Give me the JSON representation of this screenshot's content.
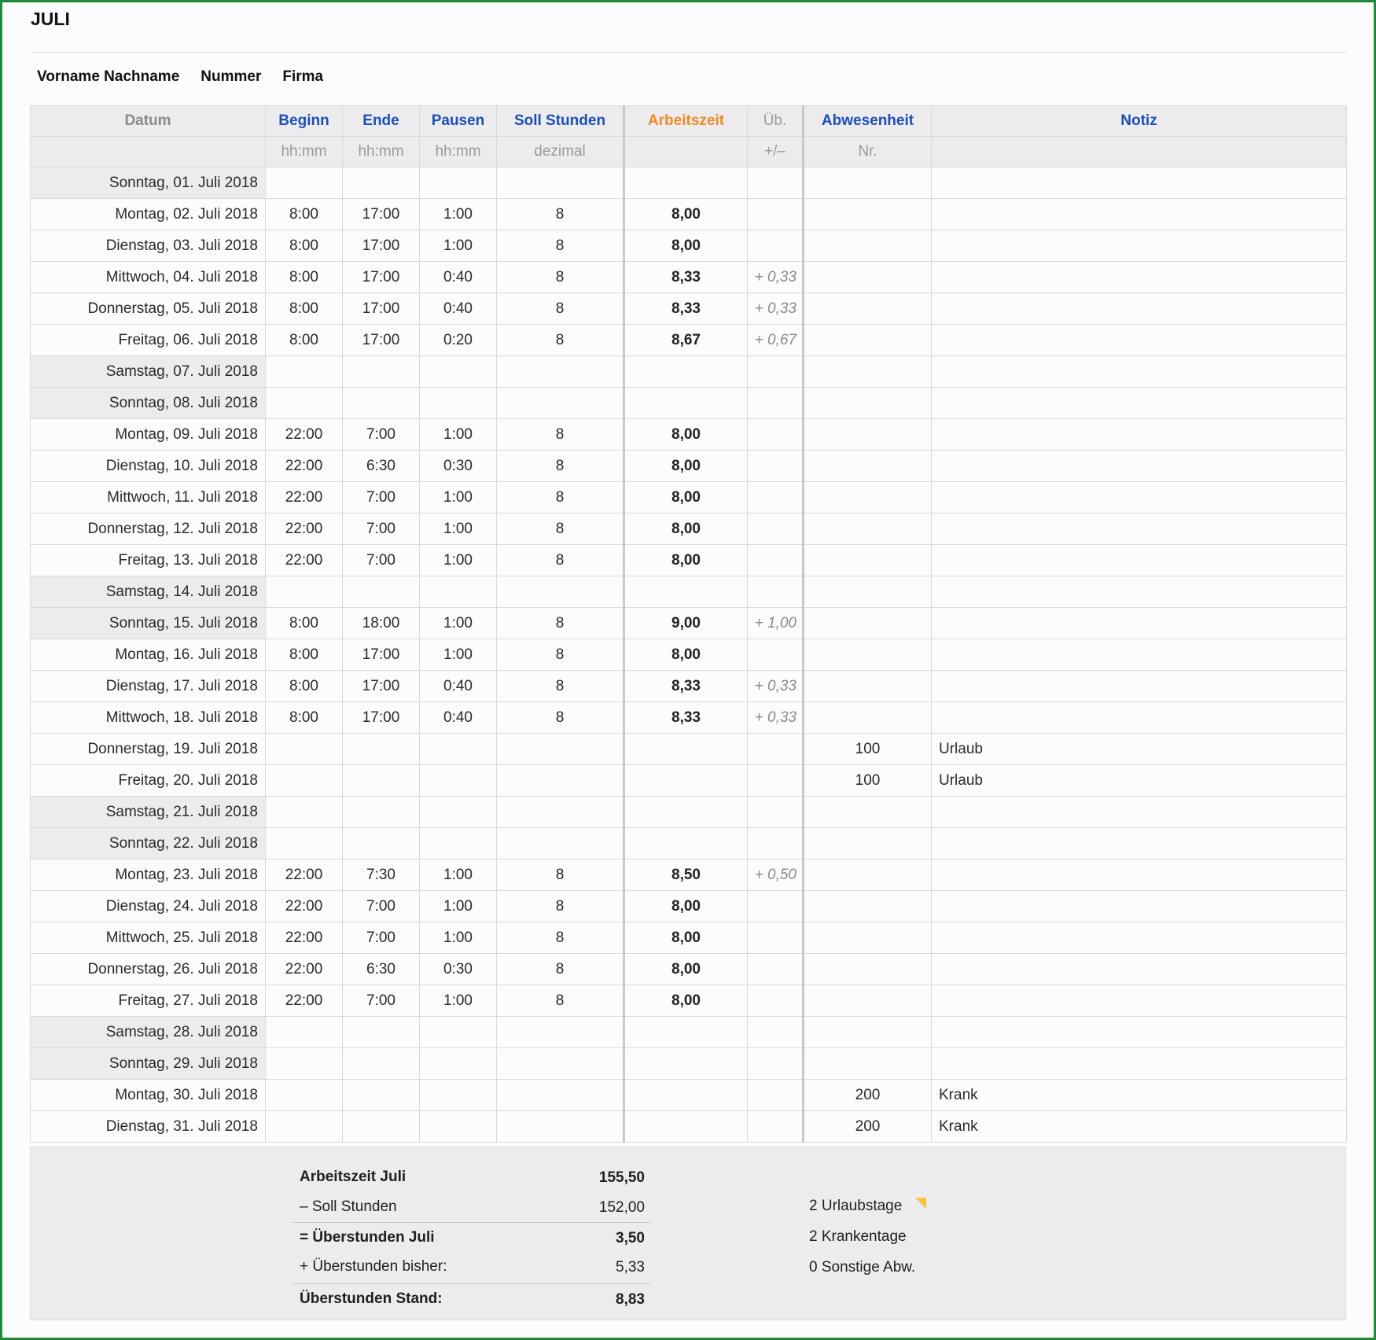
{
  "title": "JULI",
  "meta": {
    "name": "Vorname Nachname",
    "number": "Nummer",
    "company": "Firma"
  },
  "columns": {
    "datum": "Datum",
    "beginn": "Beginn",
    "ende": "Ende",
    "pausen": "Pausen",
    "soll": "Soll Stunden",
    "arbeitszeit": "Arbeitszeit",
    "ueb": "Üb.",
    "abwesenheit": "Abwesenheit",
    "notiz": "Notiz",
    "beginn_fmt": "hh:mm",
    "ende_fmt": "hh:mm",
    "pausen_fmt": "hh:mm",
    "soll_fmt": "dezimal",
    "ueb_fmt": "+/–",
    "abwesenheit_fmt": "Nr."
  },
  "rows": [
    {
      "date": "Sonntag, 01. Juli 2018",
      "weekend": true,
      "begin": "",
      "end": "",
      "pause": "",
      "soll": "",
      "work": "",
      "over": "",
      "abw": "",
      "note": ""
    },
    {
      "date": "Montag, 02. Juli 2018",
      "weekend": false,
      "begin": "8:00",
      "end": "17:00",
      "pause": "1:00",
      "soll": "8",
      "work": "8,00",
      "over": "",
      "abw": "",
      "note": ""
    },
    {
      "date": "Dienstag, 03. Juli 2018",
      "weekend": false,
      "begin": "8:00",
      "end": "17:00",
      "pause": "1:00",
      "soll": "8",
      "work": "8,00",
      "over": "",
      "abw": "",
      "note": ""
    },
    {
      "date": "Mittwoch, 04. Juli 2018",
      "weekend": false,
      "begin": "8:00",
      "end": "17:00",
      "pause": "0:40",
      "soll": "8",
      "work": "8,33",
      "over": "+ 0,33",
      "abw": "",
      "note": ""
    },
    {
      "date": "Donnerstag, 05. Juli 2018",
      "weekend": false,
      "begin": "8:00",
      "end": "17:00",
      "pause": "0:40",
      "soll": "8",
      "work": "8,33",
      "over": "+ 0,33",
      "abw": "",
      "note": ""
    },
    {
      "date": "Freitag, 06. Juli 2018",
      "weekend": false,
      "begin": "8:00",
      "end": "17:00",
      "pause": "0:20",
      "soll": "8",
      "work": "8,67",
      "over": "+ 0,67",
      "abw": "",
      "note": ""
    },
    {
      "date": "Samstag, 07. Juli 2018",
      "weekend": true,
      "begin": "",
      "end": "",
      "pause": "",
      "soll": "",
      "work": "",
      "over": "",
      "abw": "",
      "note": ""
    },
    {
      "date": "Sonntag, 08. Juli 2018",
      "weekend": true,
      "begin": "",
      "end": "",
      "pause": "",
      "soll": "",
      "work": "",
      "over": "",
      "abw": "",
      "note": ""
    },
    {
      "date": "Montag, 09. Juli 2018",
      "weekend": false,
      "begin": "22:00",
      "end": "7:00",
      "pause": "1:00",
      "soll": "8",
      "work": "8,00",
      "over": "",
      "abw": "",
      "note": ""
    },
    {
      "date": "Dienstag, 10. Juli 2018",
      "weekend": false,
      "begin": "22:00",
      "end": "6:30",
      "pause": "0:30",
      "soll": "8",
      "work": "8,00",
      "over": "",
      "abw": "",
      "note": ""
    },
    {
      "date": "Mittwoch, 11. Juli 2018",
      "weekend": false,
      "begin": "22:00",
      "end": "7:00",
      "pause": "1:00",
      "soll": "8",
      "work": "8,00",
      "over": "",
      "abw": "",
      "note": ""
    },
    {
      "date": "Donnerstag, 12. Juli 2018",
      "weekend": false,
      "begin": "22:00",
      "end": "7:00",
      "pause": "1:00",
      "soll": "8",
      "work": "8,00",
      "over": "",
      "abw": "",
      "note": ""
    },
    {
      "date": "Freitag, 13. Juli 2018",
      "weekend": false,
      "begin": "22:00",
      "end": "7:00",
      "pause": "1:00",
      "soll": "8",
      "work": "8,00",
      "over": "",
      "abw": "",
      "note": ""
    },
    {
      "date": "Samstag, 14. Juli 2018",
      "weekend": true,
      "begin": "",
      "end": "",
      "pause": "",
      "soll": "",
      "work": "",
      "over": "",
      "abw": "",
      "note": ""
    },
    {
      "date": "Sonntag, 15. Juli 2018",
      "weekend": true,
      "begin": "8:00",
      "end": "18:00",
      "pause": "1:00",
      "soll": "8",
      "work": "9,00",
      "over": "+ 1,00",
      "abw": "",
      "note": ""
    },
    {
      "date": "Montag, 16. Juli 2018",
      "weekend": false,
      "begin": "8:00",
      "end": "17:00",
      "pause": "1:00",
      "soll": "8",
      "work": "8,00",
      "over": "",
      "abw": "",
      "note": ""
    },
    {
      "date": "Dienstag, 17. Juli 2018",
      "weekend": false,
      "begin": "8:00",
      "end": "17:00",
      "pause": "0:40",
      "soll": "8",
      "work": "8,33",
      "over": "+ 0,33",
      "abw": "",
      "note": ""
    },
    {
      "date": "Mittwoch, 18. Juli 2018",
      "weekend": false,
      "begin": "8:00",
      "end": "17:00",
      "pause": "0:40",
      "soll": "8",
      "work": "8,33",
      "over": "+ 0,33",
      "abw": "",
      "note": ""
    },
    {
      "date": "Donnerstag, 19. Juli 2018",
      "weekend": false,
      "begin": "",
      "end": "",
      "pause": "",
      "soll": "",
      "work": "",
      "over": "",
      "abw": "100",
      "note": "Urlaub"
    },
    {
      "date": "Freitag, 20. Juli 2018",
      "weekend": false,
      "begin": "",
      "end": "",
      "pause": "",
      "soll": "",
      "work": "",
      "over": "",
      "abw": "100",
      "note": "Urlaub"
    },
    {
      "date": "Samstag, 21. Juli 2018",
      "weekend": true,
      "begin": "",
      "end": "",
      "pause": "",
      "soll": "",
      "work": "",
      "over": "",
      "abw": "",
      "note": ""
    },
    {
      "date": "Sonntag, 22. Juli 2018",
      "weekend": true,
      "begin": "",
      "end": "",
      "pause": "",
      "soll": "",
      "work": "",
      "over": "",
      "abw": "",
      "note": ""
    },
    {
      "date": "Montag, 23. Juli 2018",
      "weekend": false,
      "begin": "22:00",
      "end": "7:30",
      "pause": "1:00",
      "soll": "8",
      "work": "8,50",
      "over": "+ 0,50",
      "abw": "",
      "note": ""
    },
    {
      "date": "Dienstag, 24. Juli 2018",
      "weekend": false,
      "begin": "22:00",
      "end": "7:00",
      "pause": "1:00",
      "soll": "8",
      "work": "8,00",
      "over": "",
      "abw": "",
      "note": ""
    },
    {
      "date": "Mittwoch, 25. Juli 2018",
      "weekend": false,
      "begin": "22:00",
      "end": "7:00",
      "pause": "1:00",
      "soll": "8",
      "work": "8,00",
      "over": "",
      "abw": "",
      "note": ""
    },
    {
      "date": "Donnerstag, 26. Juli 2018",
      "weekend": false,
      "begin": "22:00",
      "end": "6:30",
      "pause": "0:30",
      "soll": "8",
      "work": "8,00",
      "over": "",
      "abw": "",
      "note": ""
    },
    {
      "date": "Freitag, 27. Juli 2018",
      "weekend": false,
      "begin": "22:00",
      "end": "7:00",
      "pause": "1:00",
      "soll": "8",
      "work": "8,00",
      "over": "",
      "abw": "",
      "note": ""
    },
    {
      "date": "Samstag, 28. Juli 2018",
      "weekend": true,
      "begin": "",
      "end": "",
      "pause": "",
      "soll": "",
      "work": "",
      "over": "",
      "abw": "",
      "note": ""
    },
    {
      "date": "Sonntag, 29. Juli 2018",
      "weekend": true,
      "begin": "",
      "end": "",
      "pause": "",
      "soll": "",
      "work": "",
      "over": "",
      "abw": "",
      "note": ""
    },
    {
      "date": "Montag, 30. Juli 2018",
      "weekend": false,
      "begin": "",
      "end": "",
      "pause": "",
      "soll": "",
      "work": "",
      "over": "",
      "abw": "200",
      "note": "Krank"
    },
    {
      "date": "Dienstag, 31. Juli 2018",
      "weekend": false,
      "begin": "",
      "end": "",
      "pause": "",
      "soll": "",
      "work": "",
      "over": "",
      "abw": "200",
      "note": "Krank"
    }
  ],
  "summary": {
    "work_label": "Arbeitszeit Juli",
    "work_value": "155,50",
    "soll_label": "– Soll Stunden",
    "soll_value": "152,00",
    "over_month_label": "= Überstunden Juli",
    "over_month_value": "3,50",
    "over_prev_label": "+ Überstunden bisher:",
    "over_prev_value": "5,33",
    "over_total_label": "Überstunden Stand:",
    "over_total_value": "8,83",
    "vacation": "2 Urlaubstage",
    "sick": "2 Krankentage",
    "other": "0 Sonstige Abw."
  },
  "colors": {
    "frame": "#1e8a3a",
    "header_blue": "#1d4fb4",
    "header_orange": "#ef8a26",
    "weekend_bg": "#ececef"
  }
}
